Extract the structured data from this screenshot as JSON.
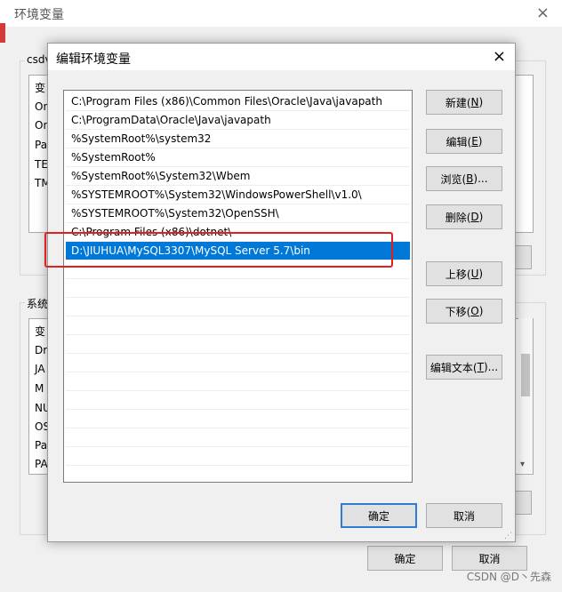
{
  "outer": {
    "title": "环境变量",
    "close_icon": "×",
    "user_group_label": "csdv",
    "user_rows": [
      "变",
      "On",
      "On",
      "Pa",
      "TE",
      "TM"
    ],
    "system_group_label": "系统",
    "system_rows": [
      "变",
      "Dr",
      "JA",
      "M",
      "NU",
      "OS",
      "Pa",
      "PA"
    ],
    "ok_label": "确定",
    "cancel_label": "取消"
  },
  "dialog": {
    "title": "编辑环境变量",
    "close_icon": "×",
    "paths": [
      "C:\\Program Files (x86)\\Common Files\\Oracle\\Java\\javapath",
      "C:\\ProgramData\\Oracle\\Java\\javapath",
      "%SystemRoot%\\system32",
      "%SystemRoot%",
      "%SystemRoot%\\System32\\Wbem",
      "%SYSTEMROOT%\\System32\\WindowsPowerShell\\v1.0\\",
      "%SYSTEMROOT%\\System32\\OpenSSH\\",
      "C:\\Program Files (x86)\\dotnet\\",
      "D:\\JIUHUA\\MySQL3307\\MySQL Server 5.7\\bin"
    ],
    "selected_index": 8,
    "buttons": {
      "new": {
        "text": "新建(",
        "key": "N",
        "tail": ")"
      },
      "edit": {
        "text": "编辑(",
        "key": "E",
        "tail": ")"
      },
      "browse": {
        "text": "浏览(",
        "key": "B",
        "tail": ")..."
      },
      "delete": {
        "text": "删除(",
        "key": "D",
        "tail": ")"
      },
      "up": {
        "text": "上移(",
        "key": "U",
        "tail": ")"
      },
      "down": {
        "text": "下移(",
        "key": "O",
        "tail": ")"
      },
      "edit_text": {
        "text": "编辑文本(",
        "key": "T",
        "tail": ")..."
      }
    },
    "ok_label": "确定",
    "cancel_label": "取消"
  },
  "watermark": "CSDN @D丶先森",
  "colors": {
    "selection": "#0078d7",
    "annotation": "#e02020",
    "default_button_border": "#2f7dd1"
  }
}
